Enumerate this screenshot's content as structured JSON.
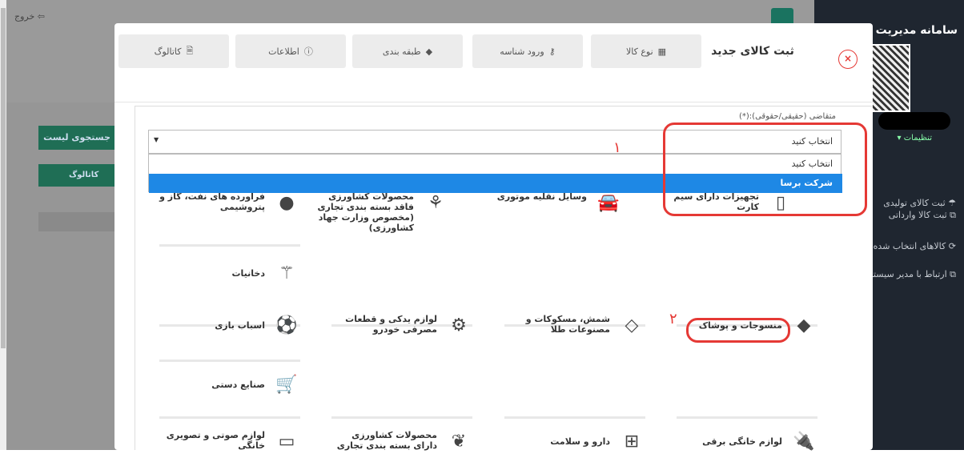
{
  "background": {
    "logout_label": "خروج",
    "search_button": "جستجوی لیست",
    "table_header": "کاتالوگ"
  },
  "sidebar": {
    "title": "سامانه مدیریت شـ",
    "settings": "تنظیمات ▾",
    "items": [
      {
        "label": "ثبت کالای تولیدی",
        "icon": "export-icon"
      },
      {
        "label": "ثبت کالا وارداتی",
        "icon": "external-link-icon"
      },
      {
        "label": "کالاهای انتخاب شده",
        "icon": "spinner-icon"
      },
      {
        "label": "ارتباط با مدیر سیستم",
        "icon": "external-link-icon"
      }
    ]
  },
  "modal": {
    "title": "ثبت کالای جدید",
    "close": "×",
    "tabs": [
      {
        "label": "نوع کالا",
        "icon": "grid-icon"
      },
      {
        "label": "ورود شناسه",
        "icon": "key-icon"
      },
      {
        "label": "طبقه بندی",
        "icon": "tag-icon"
      },
      {
        "label": "اطلاعات",
        "icon": "info-icon"
      },
      {
        "label": "کاتالوگ",
        "icon": "document-icon"
      }
    ],
    "field_label": "متقاضی (حقیقی/حقوقی):(*)",
    "select_value": "انتخاب کنید",
    "dropdown_options": [
      "انتخاب کنید",
      "شرکت برسا"
    ]
  },
  "categories": [
    {
      "label": "تجهیزات دارای سیم کارت",
      "icon": "mobile-icon"
    },
    {
      "label": "وسایل نقلیه موتوری",
      "icon": "car-icon"
    },
    {
      "label": "محصولات کشاورزی فاقد بسته بندی تجاری (مخصوص وزارت جهاد کشاورزی)",
      "icon": "plant-icon"
    },
    {
      "label": "فرآورده های نفت، گاز و پتروشیمی",
      "icon": "oil-drop-icon"
    },
    {
      "label": "دخانیات",
      "icon": "magic-wand-icon"
    },
    {
      "label": "منسوجات و پوشاک",
      "icon": "tag-icon"
    },
    {
      "label": "شمش، مسکوکات و مصنوعات طلا",
      "icon": "diamond-icon"
    },
    {
      "label": "لوازم یدکی و قطعات مصرفی خودرو",
      "icon": "gears-icon"
    },
    {
      "label": "اسباب بازی",
      "icon": "soccer-ball-icon"
    },
    {
      "label": "صنایع دستی",
      "icon": "cart-plus-icon"
    },
    {
      "label": "لوازم خانگی برقی",
      "icon": "plug-icon"
    },
    {
      "label": "دارو و سلامت",
      "icon": "plus-square-icon"
    },
    {
      "label": "محصولات کشاورزی دارای بسته بندی تجاری",
      "icon": "leaf-icon"
    },
    {
      "label": "لوازم صوتی و تصویری خانگی",
      "icon": "tv-icon"
    }
  ],
  "annotations": {
    "marker1": "۱",
    "marker2": "۲"
  }
}
